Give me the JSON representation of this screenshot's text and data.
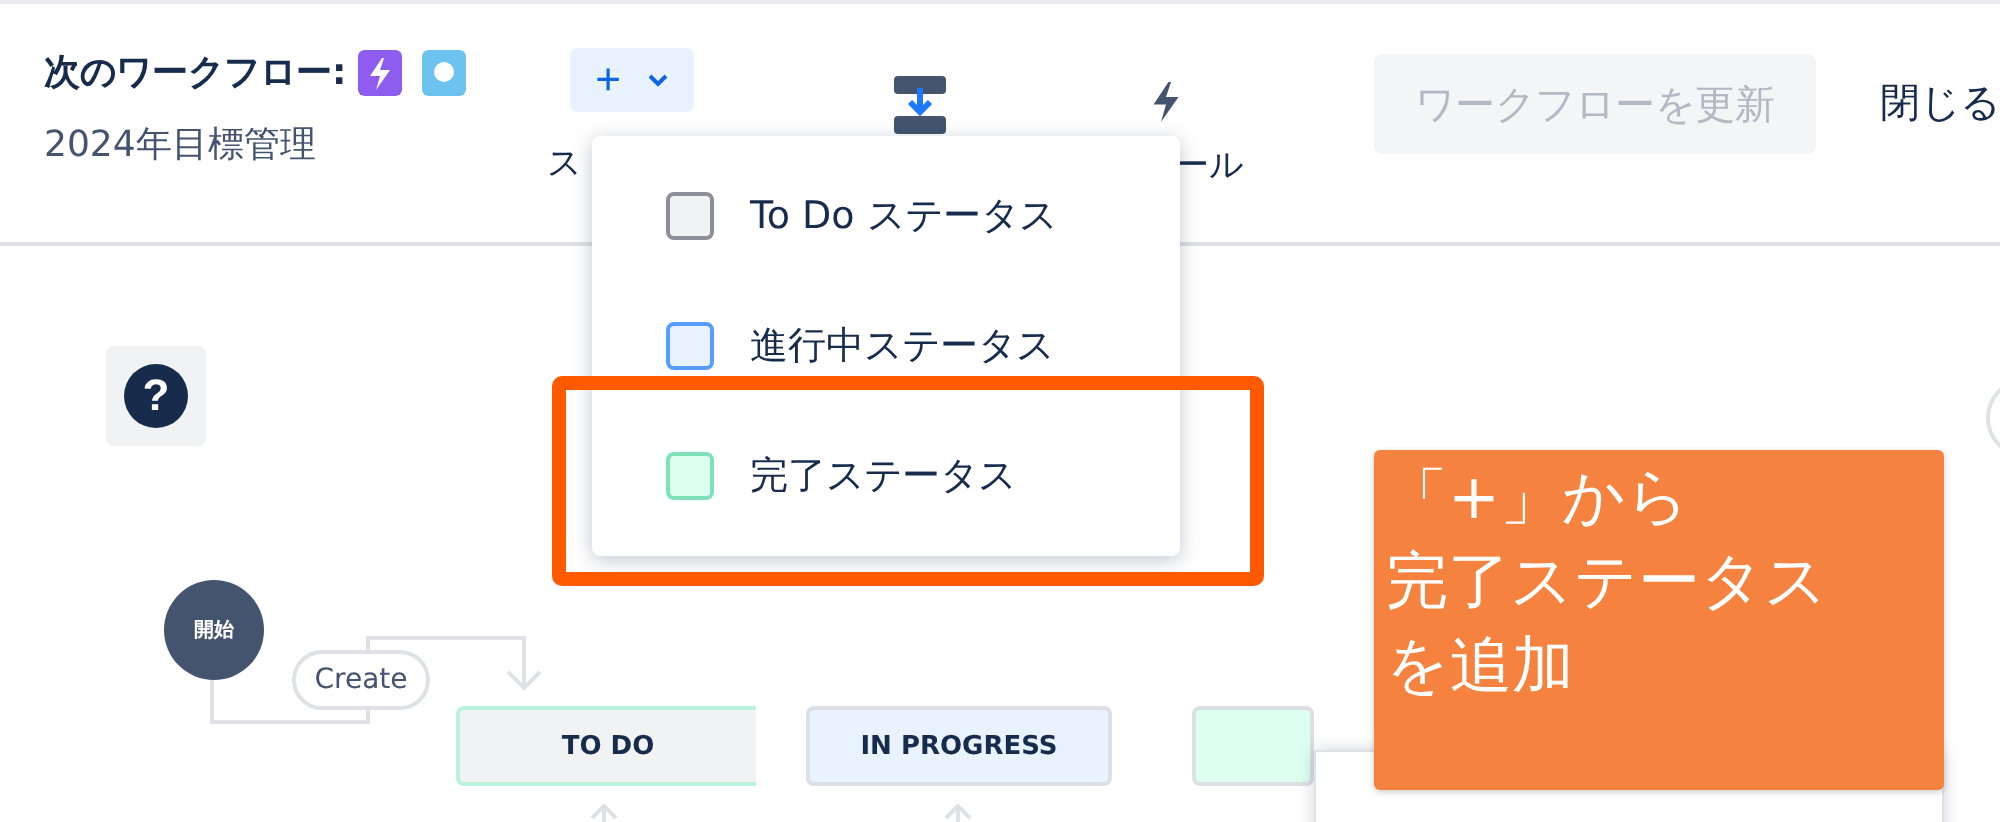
{
  "header": {
    "title": "次のワークフロー:",
    "subtitle": "2024年目標管理"
  },
  "toolbar": [
    {
      "kind": "add",
      "icon": "+",
      "label": "ス"
    },
    {
      "kind": "import"
    },
    {
      "kind": "rules",
      "label": "ール"
    }
  ],
  "update_button": {
    "label": "ワークフローを更新",
    "disabled": true
  },
  "close_button": {
    "label": "閉じる"
  },
  "dropdown": {
    "items": [
      {
        "label": "To Do ステータス",
        "color": "#f1f2f4"
      },
      {
        "label": "進行中ステータス",
        "color": "#e9f2ff"
      },
      {
        "label": "完了ステータス",
        "color": "#dcfff1"
      }
    ]
  },
  "help": {
    "label": "?"
  },
  "diagram": {
    "start": "開始",
    "transition": "Create",
    "statuses": [
      {
        "label": "TO DO",
        "color": "#f1f2f4"
      },
      {
        "label": "IN PROGRESS",
        "color": "#e9f2ff"
      },
      {
        "color": "#dcfff1"
      }
    ]
  },
  "annotation": {
    "lines": [
      "「+」から",
      "完了ステータス",
      "を追加"
    ]
  }
}
